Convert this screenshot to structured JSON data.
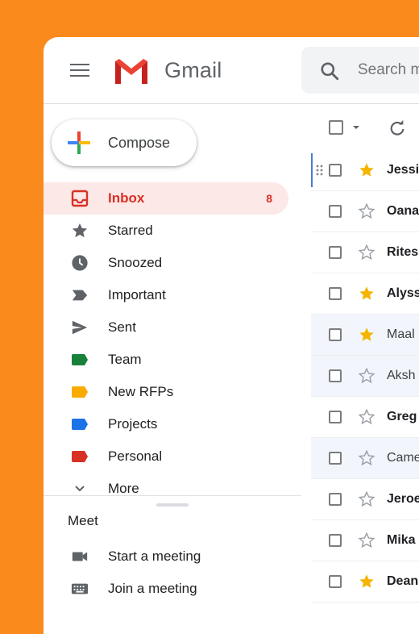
{
  "app": {
    "name": "Gmail",
    "menu_icon": "hamburger-menu-icon"
  },
  "search": {
    "placeholder": "Search mail"
  },
  "compose": {
    "label": "Compose"
  },
  "nav": {
    "items": [
      {
        "label": "Inbox",
        "icon": "inbox-icon",
        "count": "8",
        "active": true
      },
      {
        "label": "Starred",
        "icon": "star-icon"
      },
      {
        "label": "Snoozed",
        "icon": "clock-icon"
      },
      {
        "label": "Important",
        "icon": "important-icon"
      },
      {
        "label": "Sent",
        "icon": "send-icon"
      },
      {
        "label": "Team",
        "icon": "label-icon",
        "color": "#188038"
      },
      {
        "label": "New RFPs",
        "icon": "label-icon",
        "color": "#f9ab00"
      },
      {
        "label": "Projects",
        "icon": "label-icon",
        "color": "#1a73e8"
      },
      {
        "label": "Personal",
        "icon": "label-icon",
        "color": "#d93025"
      },
      {
        "label": "More",
        "icon": "chevron-down-icon"
      }
    ]
  },
  "meet": {
    "title": "Meet",
    "items": [
      {
        "label": "Start a meeting",
        "icon": "video-camera-icon"
      },
      {
        "label": "Join a meeting",
        "icon": "keyboard-icon"
      }
    ]
  },
  "colors": {
    "accent": "#d93025",
    "active_bg": "#fce8e6",
    "star": "#f4b400",
    "background": "#fb8a1c"
  },
  "messages": [
    {
      "sender": "Jessi",
      "starred": true,
      "unread": true
    },
    {
      "sender": "Oana",
      "starred": false,
      "unread": true
    },
    {
      "sender": "Rites",
      "starred": false,
      "unread": true
    },
    {
      "sender": "Alyss",
      "starred": true,
      "unread": true
    },
    {
      "sender": "Maal",
      "starred": true,
      "unread": false
    },
    {
      "sender": "Aksh",
      "starred": false,
      "unread": false
    },
    {
      "sender": "Greg",
      "starred": false,
      "unread": true
    },
    {
      "sender": "Came",
      "starred": false,
      "unread": false
    },
    {
      "sender": "Jeroe",
      "starred": false,
      "unread": true
    },
    {
      "sender": "Mika",
      "starred": false,
      "unread": true
    },
    {
      "sender": "Dean",
      "starred": true,
      "unread": true
    }
  ]
}
